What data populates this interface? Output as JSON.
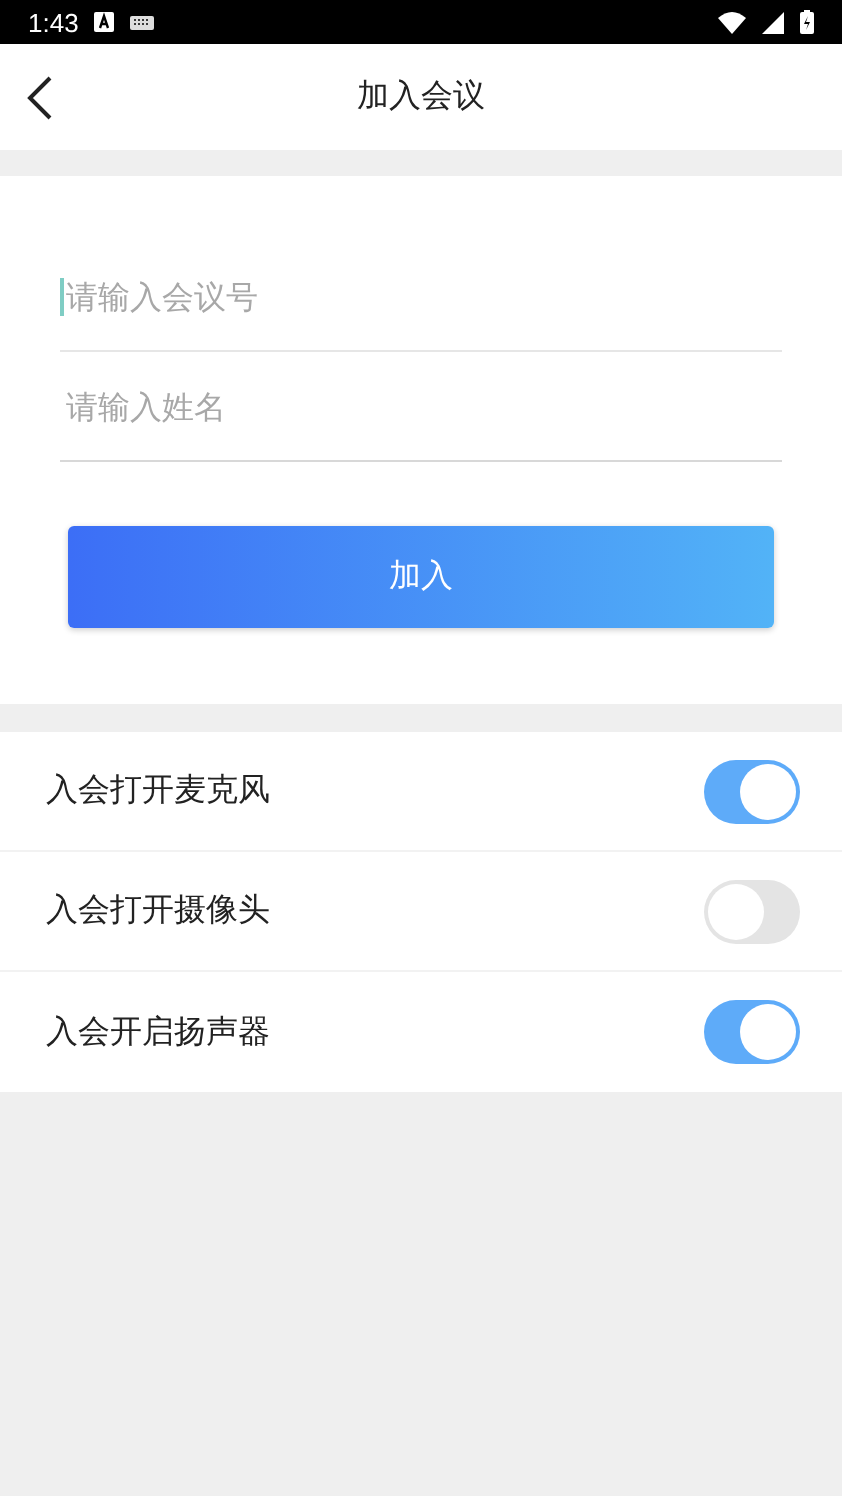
{
  "status_bar": {
    "time": "1:43"
  },
  "header": {
    "title": "加入会议"
  },
  "form": {
    "fields": [
      {
        "placeholder": "请输入会议号",
        "focused": true
      },
      {
        "placeholder": "请输入姓名",
        "focused": false
      }
    ],
    "submit": "加入"
  },
  "settings": [
    {
      "label": "入会打开麦克风",
      "on": true
    },
    {
      "label": "入会打开摄像头",
      "on": false
    },
    {
      "label": "入会开启扬声器",
      "on": true
    }
  ]
}
